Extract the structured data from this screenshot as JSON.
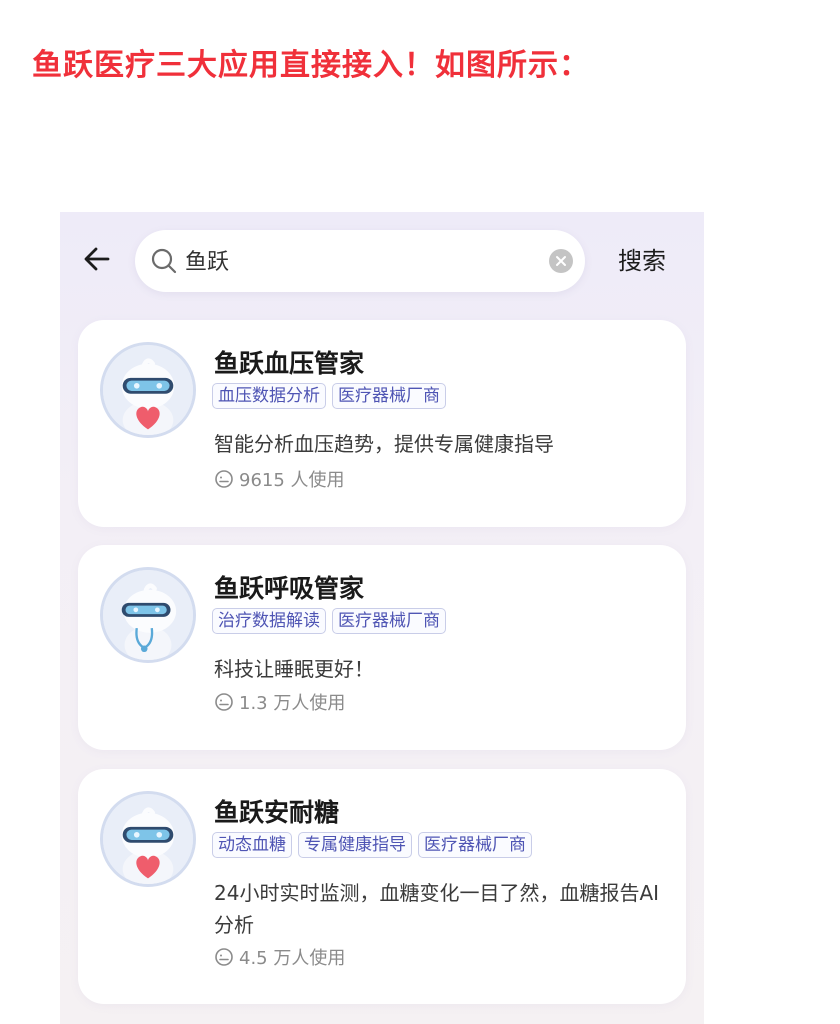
{
  "headline": "鱼跃医疗三大应用直接接入！如图所示：",
  "search": {
    "value": "鱼跃",
    "action_label": "搜索"
  },
  "icons": {
    "back": "arrow-left-icon",
    "search": "search-icon",
    "clear": "clear-circle-icon",
    "usage": "user-chat-icon",
    "avatar": "robot-mascot-icon"
  },
  "colors": {
    "headline": "#f0303a",
    "tag_text": "#4f55b4",
    "tag_border": "#c9cde8",
    "page_background": "#eeebf8"
  },
  "results": [
    {
      "title": "鱼跃血压管家",
      "tags": [
        "血压数据分析",
        "医疗器械厂商"
      ],
      "description": "智能分析血压趋势，提供专属健康指导",
      "usage": "9615 人使用"
    },
    {
      "title": "鱼跃呼吸管家",
      "tags": [
        "治疗数据解读",
        "医疗器械厂商"
      ],
      "description": "科技让睡眠更好！",
      "usage": "1.3 万人使用"
    },
    {
      "title": "鱼跃安耐糖",
      "tags": [
        "动态血糖",
        "专属健康指导",
        "医疗器械厂商"
      ],
      "description": "24小时实时监测，血糖变化一目了然，血糖报告AI分析",
      "usage": "4.5 万人使用"
    }
  ]
}
